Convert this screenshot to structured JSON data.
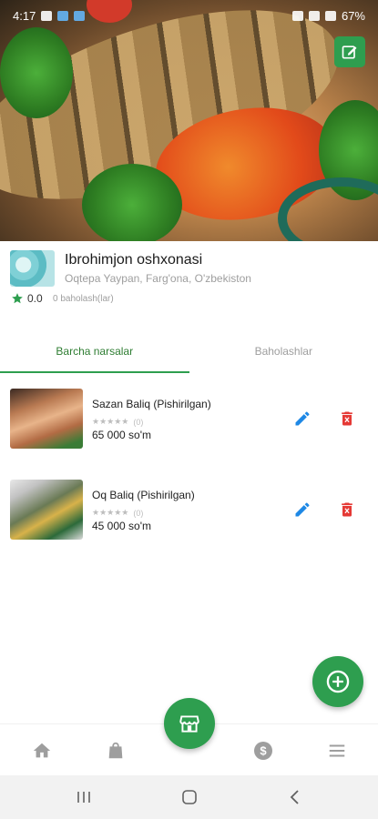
{
  "status_bar": {
    "time": "4:17",
    "battery": "67%"
  },
  "restaurant": {
    "name": "Ibrohimjon oshxonasi",
    "address": "Oqtepa Yaypan, Farg'ona, O'zbekiston",
    "rating": "0.0",
    "rating_count": "0 baholash(lar)"
  },
  "tabs": [
    {
      "label": "Barcha narsalar",
      "active": true
    },
    {
      "label": "Baholashlar",
      "active": false
    }
  ],
  "products": [
    {
      "title": "Sazan Baliq (Pishirilgan)",
      "stars": "★★★★★",
      "rating_count": "(0)",
      "price": "65 000 so'm"
    },
    {
      "title": "Oq Baliq (Pishirilgan)",
      "stars": "★★★★★",
      "rating_count": "(0)",
      "price": "45 000 so'm"
    }
  ],
  "icons": {
    "edit_restaurant": "edit-square-icon",
    "edit_product": "pencil-icon",
    "delete_product": "trash-icon",
    "add_product": "plus-circle-icon",
    "home": "home-icon",
    "orders": "shopping-bag-icon",
    "store": "store-icon",
    "money": "dollar-circle-icon",
    "menu": "hamburger-menu-icon"
  },
  "colors": {
    "accent": "#2e9e4f",
    "active_tab": "#2e7d32",
    "edit_blue": "#1e88e5",
    "delete_red": "#e53935",
    "star": "#2e9e4f"
  }
}
